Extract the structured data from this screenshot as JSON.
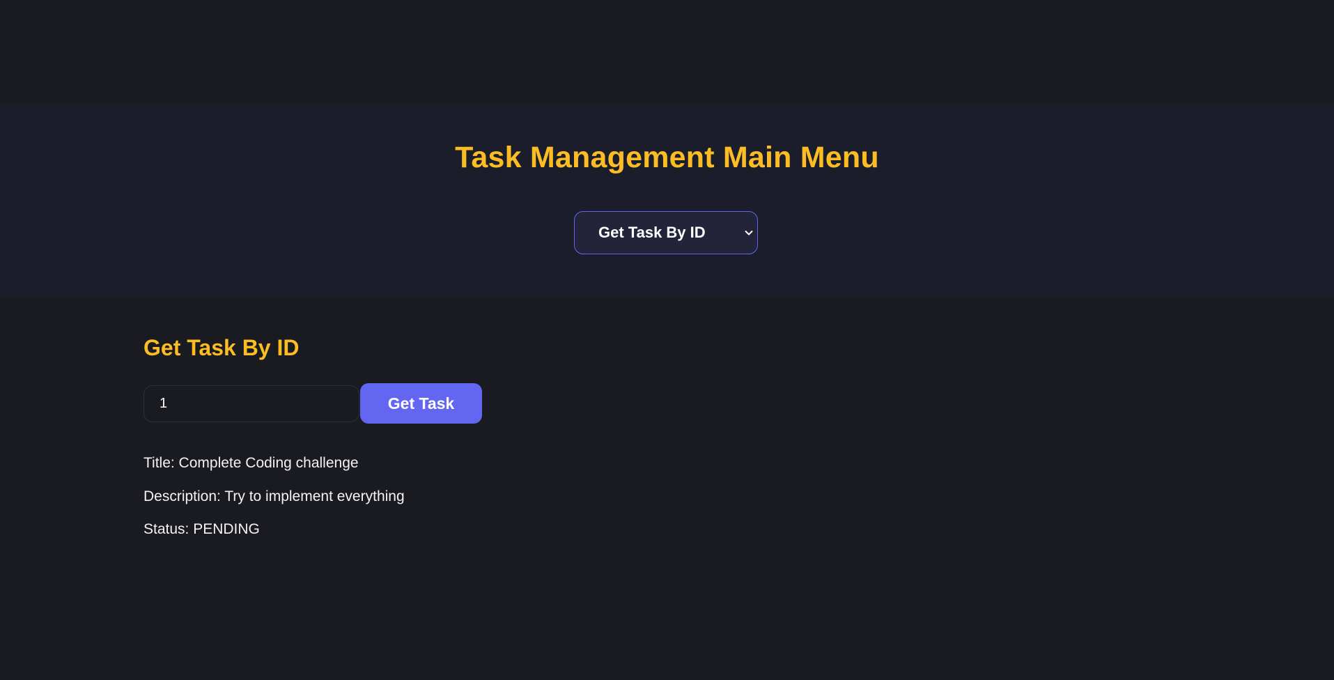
{
  "header": {
    "title": "Task Management Main Menu",
    "menu_select": {
      "selected": "Get Task By ID",
      "icon": "chevron-down-icon"
    }
  },
  "section": {
    "title": "Get Task By ID",
    "id_input_value": "1",
    "button_label": "Get Task"
  },
  "result": {
    "title_line": "Title: Complete Coding challenge",
    "description_line": "Description: Try to implement everything",
    "status_line": "Status: PENDING"
  },
  "colors": {
    "page_background": "#1a1b20",
    "header_band": "#1c1d2b",
    "accent_yellow": "#fbbd23",
    "accent_indigo": "#6366f1"
  }
}
